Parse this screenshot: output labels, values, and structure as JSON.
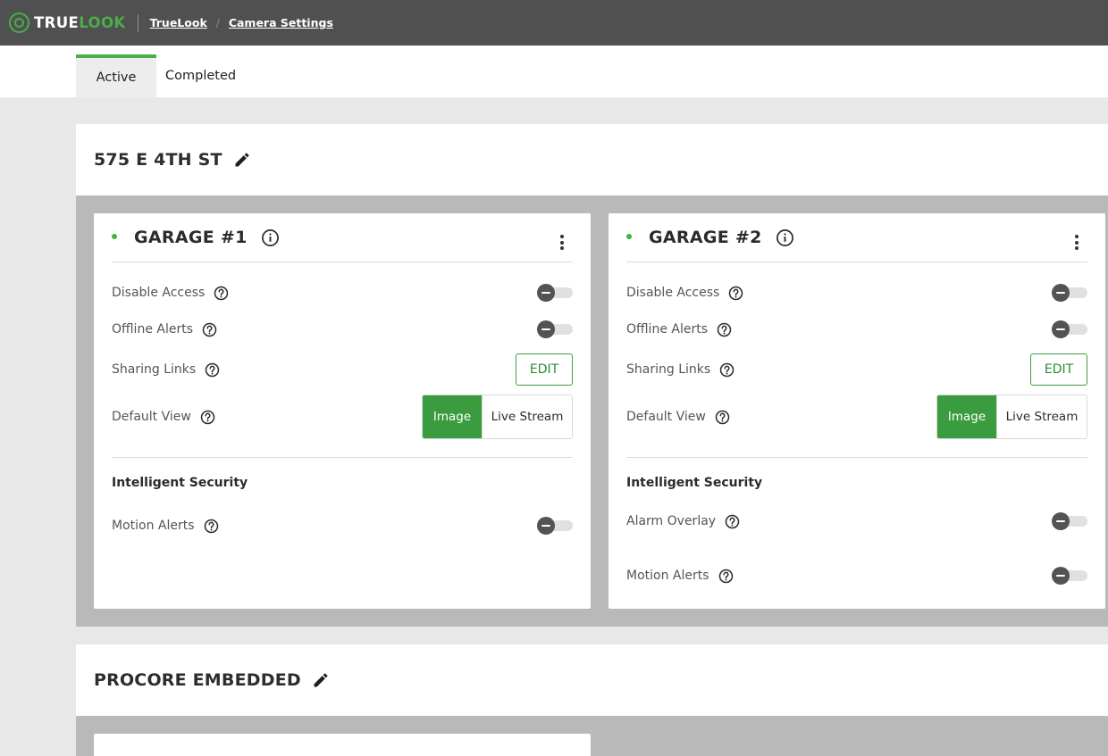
{
  "brand": {
    "logo_true": "TRUE",
    "logo_look": "LOOK",
    "accent": "#49ad4a"
  },
  "breadcrumb": {
    "items": [
      "TrueLook",
      "Camera Settings"
    ],
    "separator": "/"
  },
  "tabs": [
    {
      "label": "Active",
      "selected": true
    },
    {
      "label": "Completed",
      "selected": false
    }
  ],
  "projects": [
    {
      "title": "575 E 4TH ST",
      "cameras": [
        {
          "name": "GARAGE #1",
          "status": "online",
          "settings": {
            "disable_access": "Disable Access",
            "offline_alerts": "Offline Alerts",
            "sharing_links": "Sharing Links",
            "edit_label": "EDIT",
            "default_view": "Default View",
            "view_options": [
              "Image",
              "Live Stream"
            ],
            "selected_view": "Image"
          },
          "intelligent_security": {
            "title": "Intelligent Security",
            "items": [
              "Motion Alerts"
            ]
          }
        },
        {
          "name": "GARAGE #2",
          "status": "online",
          "settings": {
            "disable_access": "Disable Access",
            "offline_alerts": "Offline Alerts",
            "sharing_links": "Sharing Links",
            "edit_label": "EDIT",
            "default_view": "Default View",
            "view_options": [
              "Image",
              "Live Stream"
            ],
            "selected_view": "Image"
          },
          "intelligent_security": {
            "title": "Intelligent Security",
            "items": [
              "Alarm Overlay",
              "Motion Alerts"
            ]
          }
        }
      ]
    },
    {
      "title": "PROCORE EMBEDDED",
      "cameras": []
    }
  ]
}
